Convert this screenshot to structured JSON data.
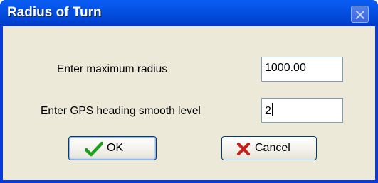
{
  "window": {
    "title": "Radius of Turn",
    "close_icon": "close-icon"
  },
  "form": {
    "max_radius_label": "Enter maximum radius",
    "max_radius_value": "1000.00",
    "smooth_label": "Enter GPS heading smooth level",
    "smooth_value": "2"
  },
  "buttons": {
    "ok_label": "OK",
    "ok_icon": "checkmark-icon",
    "cancel_label": "Cancel",
    "cancel_icon": "x-icon"
  },
  "colors": {
    "titlebar": "#0054e3",
    "client_bg": "#ece9d8",
    "ok_icon": "#1f9d1f",
    "cancel_icon": "#c8201a"
  }
}
